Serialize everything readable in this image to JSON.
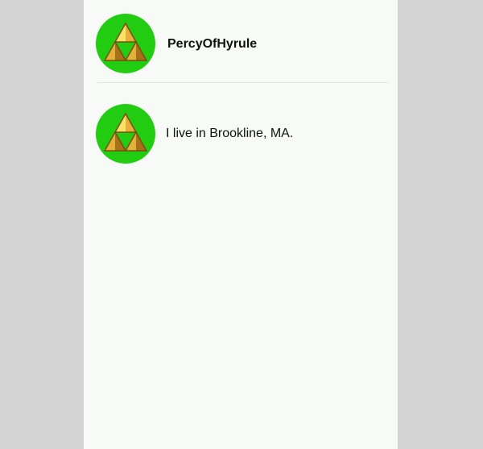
{
  "profile": {
    "username": "PercyOfHyrule",
    "avatar_icon": "triforce-icon"
  },
  "posts": [
    {
      "text": "I live in Brookline, MA.",
      "avatar_icon": "triforce-icon"
    }
  ],
  "colors": {
    "page_background": "#d4d4d4",
    "panel_background": "#f8faf8",
    "avatar_background": "#22cc11",
    "triforce_gold": "#e3b13a",
    "triforce_dark": "#a9701a",
    "triforce_light": "#fbe16a",
    "text": "#111111"
  }
}
